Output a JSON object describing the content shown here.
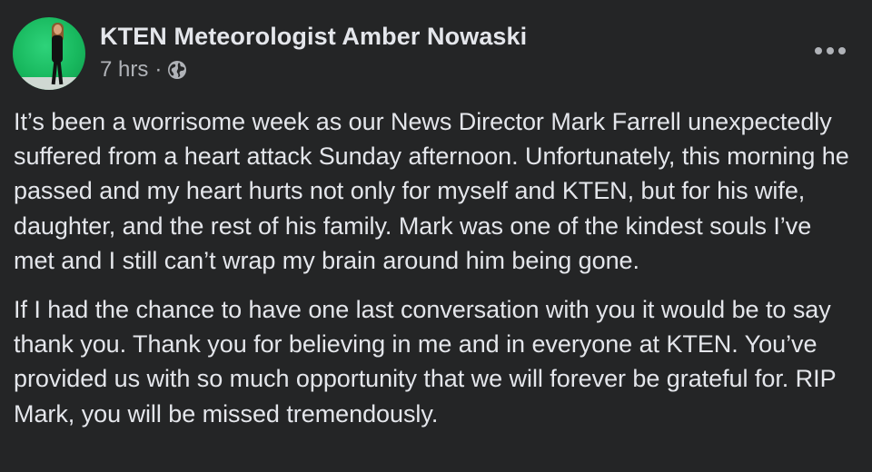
{
  "post": {
    "author": "KTEN Meteorologist Amber Nowaski",
    "timestamp": "7 hrs",
    "separator": "·",
    "audience_icon": "globe-icon",
    "more_icon": "more-options-icon",
    "paragraphs": [
      "It’s been a worrisome week as our News Director Mark Farrell unexpectedly suffered from a heart attack Sunday afternoon. Unfortunately, this morning he passed and my heart hurts not only for myself and KTEN, but for his wife, daughter, and the rest of his family. Mark was one of the kindest souls I’ve met and I still can’t wrap my brain around him being gone.",
      "If I had the chance to have one last conversation with you it would be to say thank you. Thank you for believing in me and in everyone at KTEN. You’ve provided us with so much opportunity that we will forever be grateful for. RIP Mark, you will be missed tremendously."
    ]
  },
  "colors": {
    "background": "#242526",
    "primary_text": "#e4e6eb",
    "secondary_text": "#b0b3b8",
    "avatar_green": "#18b85e"
  }
}
